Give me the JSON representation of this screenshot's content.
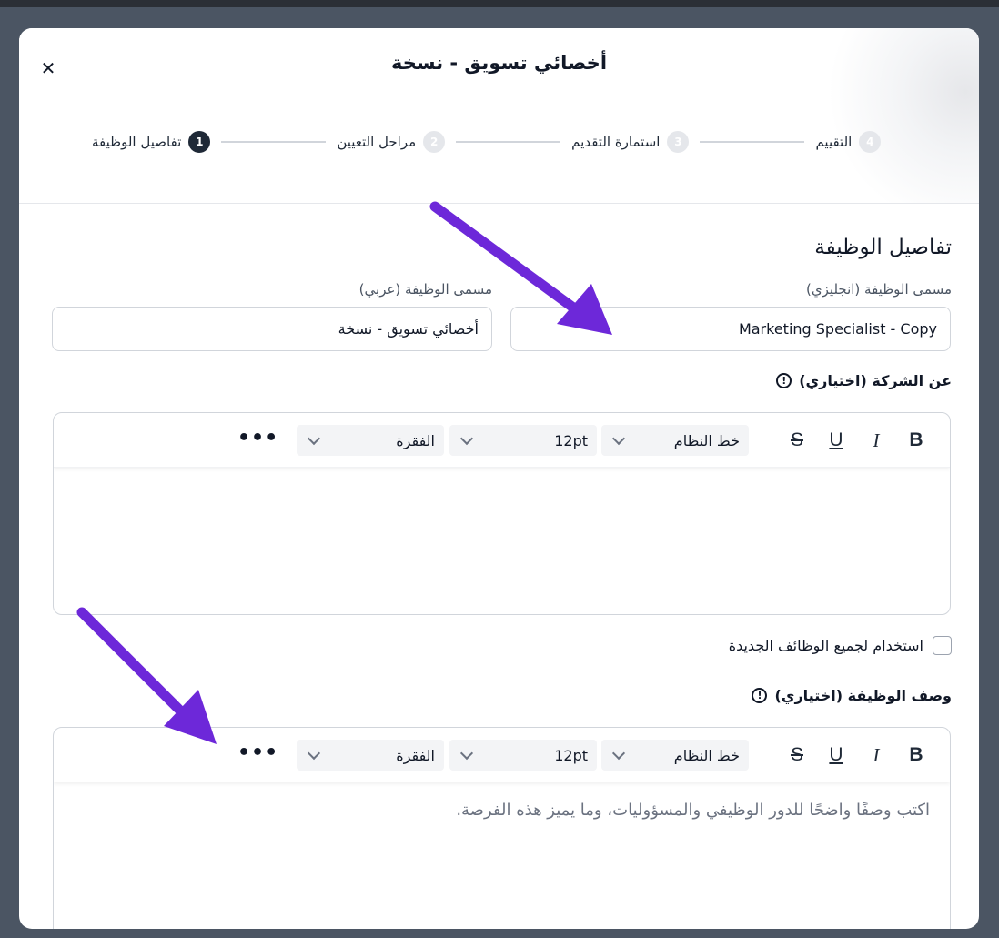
{
  "modal": {
    "title": "أخصائي تسويق - نسخة",
    "close_label": "✕"
  },
  "stepper": [
    {
      "num": "1",
      "label": "تفاصيل الوظيفة",
      "active": true
    },
    {
      "num": "2",
      "label": "مراحل التعيين",
      "active": false
    },
    {
      "num": "3",
      "label": "استمارة التقديم",
      "active": false
    },
    {
      "num": "4",
      "label": "التقييم",
      "active": false
    }
  ],
  "section": {
    "title": "تفاصيل الوظيفة"
  },
  "fields": {
    "title_en_label": "مسمى الوظيفة (انجليزي)",
    "title_en_value": "Marketing Specialist  - Copy",
    "title_ar_label": "مسمى الوظيفة (عربي)",
    "title_ar_value": "أخصائي تسويق - نسخة"
  },
  "about_company": {
    "label": "عن الشركة (اختياري)",
    "info_icon": "!"
  },
  "toolbar": {
    "bold": "B",
    "italic": "I",
    "underline": "U",
    "strike": "S",
    "font_value": "خط النظام",
    "size_value": "12pt",
    "block_value": "الفقرة",
    "more": "•••"
  },
  "checkbox": {
    "label": "استخدام لجميع الوظائف الجديدة",
    "checked": false
  },
  "job_description": {
    "label": "وصف الوظيفة (اختياري)",
    "info_icon": "!",
    "placeholder": "اكتب وصفًا واضحًا للدور الوظيفي والمسؤوليات، وما يميز هذه الفرصة."
  },
  "colors": {
    "arrow": "#6d28d9",
    "overlay": "#4b5563",
    "active_step": "#1f2937"
  }
}
